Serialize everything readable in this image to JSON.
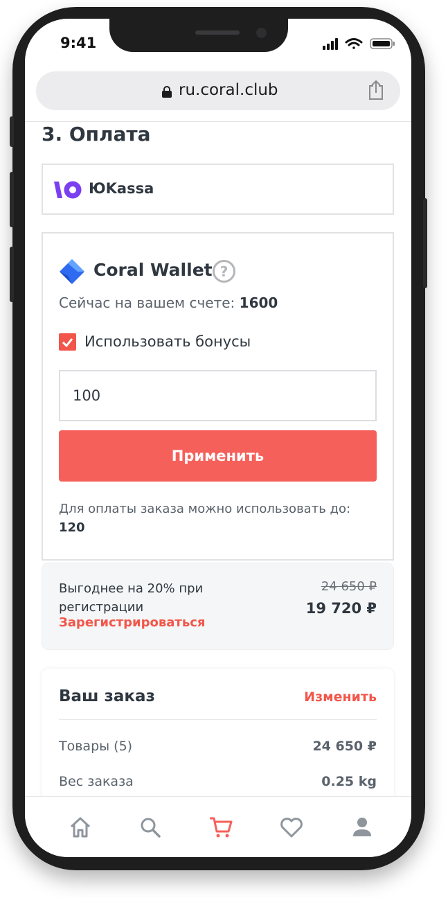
{
  "status_bar": {
    "time": "9:41"
  },
  "browser": {
    "url": "ru.coral.club"
  },
  "section": {
    "title": "3. Оплата"
  },
  "yukassa": {
    "label": "ЮKassa"
  },
  "wallet": {
    "title": "Coral Wallet",
    "help_symbol": "?",
    "balance_label": "Сейчас на вашем счете: ",
    "balance_value": "1600",
    "use_bonus_label": "Использовать бонусы",
    "use_bonus_checked": true,
    "bonus_input_value": "100",
    "apply_label": "Применить",
    "limit_label": "Для оплаты заказа можно использовать до:",
    "limit_value": "120"
  },
  "promo": {
    "text": "Выгоднее на 20% при регистрации",
    "link": "Зарегистрироваться",
    "old_price": "24 650 ₽",
    "new_price": "19 720 ₽"
  },
  "order": {
    "title": "Ваш заказ",
    "edit_label": "Изменить",
    "rows": [
      {
        "label": "Товары (5)",
        "value": "24 650 ₽"
      },
      {
        "label": "Вес заказа",
        "value": "0.25 kg"
      }
    ]
  },
  "tabbar": {
    "active": "cart",
    "tabs": [
      "home-icon",
      "search-icon",
      "cart-icon",
      "heart-icon",
      "profile-icon"
    ]
  },
  "colors": {
    "accent": "#f6605a",
    "yukassa": "#7b3ff2",
    "wallet": "#2f6bf0",
    "text": "#2f3740"
  }
}
